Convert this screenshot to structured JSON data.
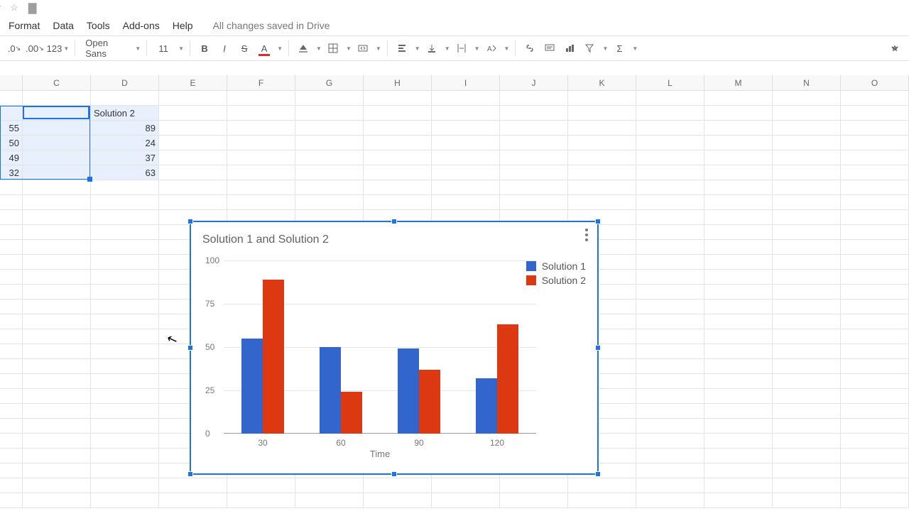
{
  "titlebar": {
    "docname_fragment": "t"
  },
  "menubar": {
    "items": [
      "Format",
      "Data",
      "Tools",
      "Add-ons",
      "Help"
    ],
    "saved": "All changes saved in Drive"
  },
  "toolbar": {
    "dec0": ".0",
    "dec00": ".00",
    "numfmt": "123",
    "font": "Open Sans",
    "size": "11"
  },
  "columns": [
    "C",
    "D",
    "E",
    "F",
    "G",
    "H",
    "I",
    "J",
    "K",
    "L",
    "M",
    "N",
    "O"
  ],
  "col_widths": {
    "stub": 32,
    "C": 96,
    "D": 96,
    "E": 96,
    "F": 96,
    "G": 96,
    "H": 96,
    "I": 96,
    "J": 96,
    "K": 96,
    "L": 96,
    "M": 96,
    "N": 96,
    "O": 96
  },
  "cells": {
    "header": {
      "D": "Solution 2"
    },
    "rows": [
      {
        "C": "55",
        "D": "89"
      },
      {
        "C": "50",
        "D": "24"
      },
      {
        "C": "49",
        "D": "37"
      },
      {
        "C": "32",
        "D": "63"
      }
    ]
  },
  "chart_data": {
    "type": "bar",
    "title": "Solution 1 and Solution 2",
    "xlabel": "Time",
    "ylabel": "",
    "categories": [
      "30",
      "60",
      "90",
      "120"
    ],
    "series": [
      {
        "name": "Solution 1",
        "color": "#3366cc",
        "values": [
          55,
          50,
          49,
          32
        ]
      },
      {
        "name": "Solution 2",
        "color": "#dc3912",
        "values": [
          89,
          24,
          37,
          63
        ]
      }
    ],
    "yticks": [
      0,
      25,
      50,
      75,
      100
    ],
    "ylim": [
      0,
      100
    ]
  }
}
